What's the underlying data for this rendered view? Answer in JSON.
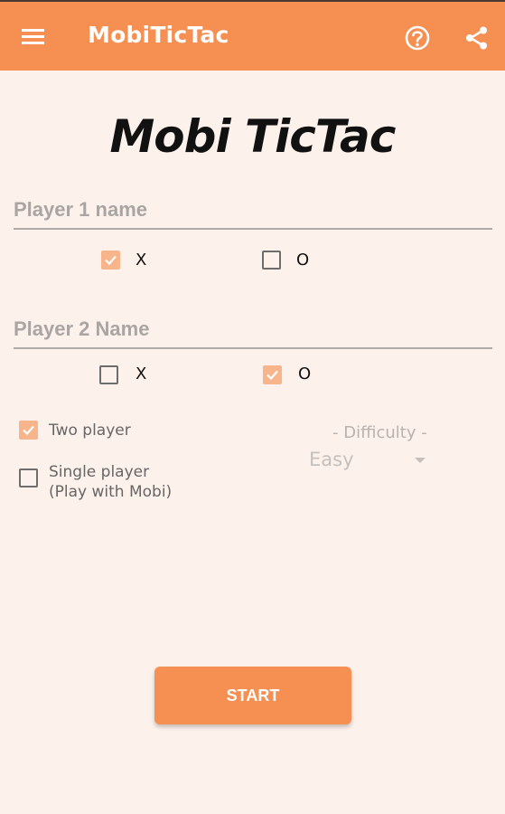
{
  "colors": {
    "accent": "#f58f52",
    "background": "#fdf1eb",
    "checkbox_checked": "#f8b48a"
  },
  "appbar": {
    "menu_icon": "hamburger-menu-icon",
    "title": "MobiTicTac",
    "help_icon": "help-circle-icon",
    "share_icon": "share-icon"
  },
  "heading": "Mobi TicTac",
  "player1": {
    "placeholder": "Player 1 name",
    "options": [
      {
        "label": "X",
        "checked": true
      },
      {
        "label": "O",
        "checked": false
      }
    ]
  },
  "player2": {
    "placeholder": "Player 2 Name",
    "options": [
      {
        "label": "X",
        "checked": false
      },
      {
        "label": "O",
        "checked": true
      }
    ]
  },
  "modes": [
    {
      "label": "Two player",
      "checked": true
    },
    {
      "label": "Single player\n(Play with Mobi)",
      "checked": false
    }
  ],
  "difficulty": {
    "label": "- Difficulty -",
    "value": "Easy"
  },
  "start_label": "START"
}
